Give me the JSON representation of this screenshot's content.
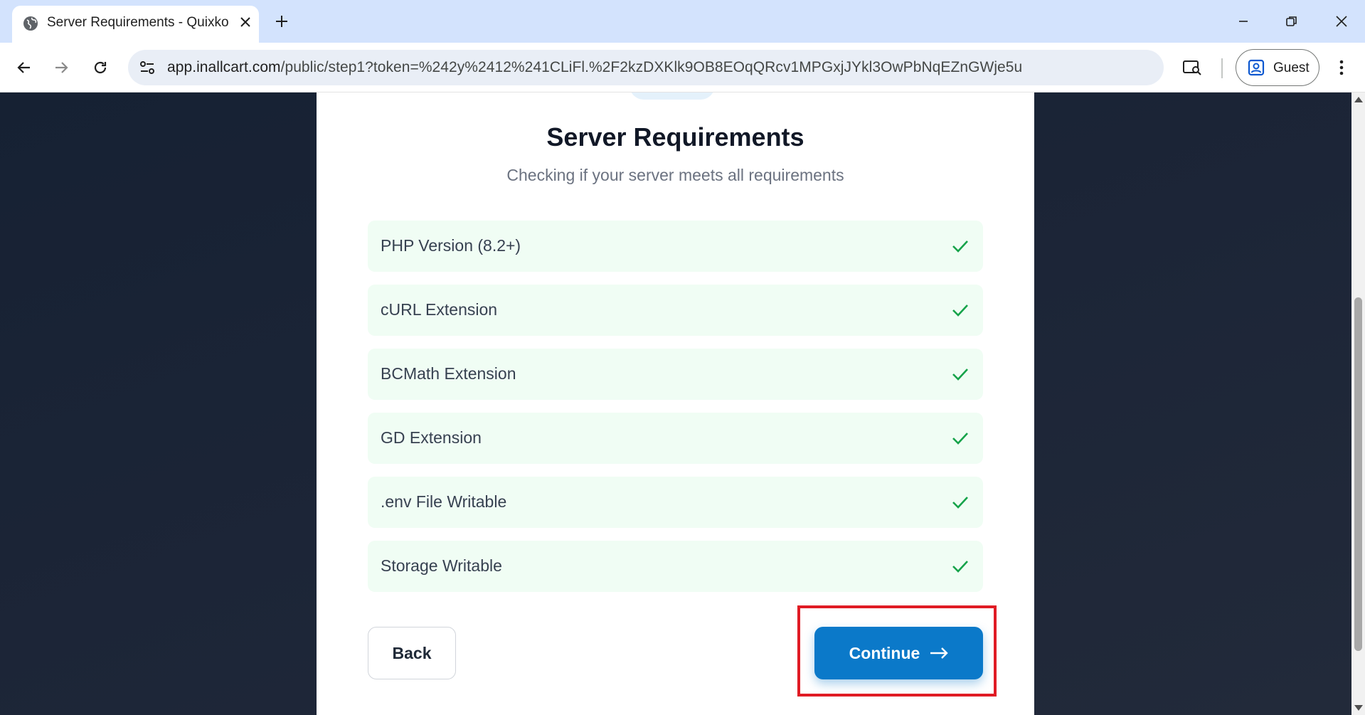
{
  "browser": {
    "tab_title": "Server Requirements - Quixko",
    "url_host": "app.inallcart.com",
    "url_path": "/public/step1?token=%242y%2412%241CLiFl.%2F2kzDXKlk9OB8EOqQRcv1MPGxjJYkl3OwPbNqEZnGWje5u",
    "profile_label": "Guest"
  },
  "page": {
    "title": "Server Requirements",
    "subtitle": "Checking if your server meets all requirements",
    "requirements": [
      {
        "label": "PHP Version (8.2+)",
        "status": "passed"
      },
      {
        "label": "cURL Extension",
        "status": "passed"
      },
      {
        "label": "BCMath Extension",
        "status": "passed"
      },
      {
        "label": "GD Extension",
        "status": "passed"
      },
      {
        "label": ".env File Writable",
        "status": "passed"
      },
      {
        "label": "Storage Writable",
        "status": "passed"
      }
    ],
    "back_label": "Back",
    "continue_label": "Continue",
    "continue_arrow": "⟶"
  },
  "colors": {
    "accent": "#0b79c9",
    "success": "#16a34a",
    "success_bg": "#f0fdf4",
    "highlight": "#e01b24"
  },
  "icons": {
    "favicon": "globe-icon",
    "check": "check-icon",
    "arrow": "arrow-right-icon"
  }
}
